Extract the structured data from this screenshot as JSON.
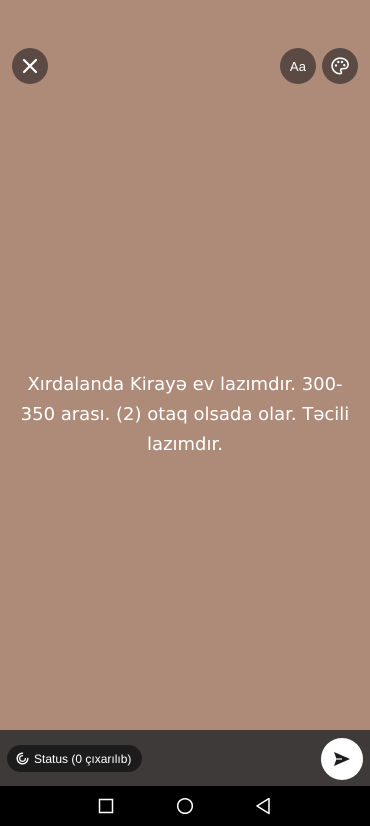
{
  "toolbar": {
    "font_button_label": "Aa",
    "close_icon": "close-icon",
    "palette_icon": "palette-icon"
  },
  "status": {
    "text": "Xırdalanda Kirayə ev lazımdır. 300-350 arası. (2) otaq olsada olar. Təcili lazımdır.",
    "background_color": "#ae8b79"
  },
  "footer": {
    "audience_label": "Status (0 çıxarılıb)",
    "audience_icon": "status-ring-icon",
    "send_icon": "send-icon"
  },
  "navigation": {
    "recents_icon": "square-icon",
    "home_icon": "circle-icon",
    "back_icon": "triangle-back-icon"
  }
}
